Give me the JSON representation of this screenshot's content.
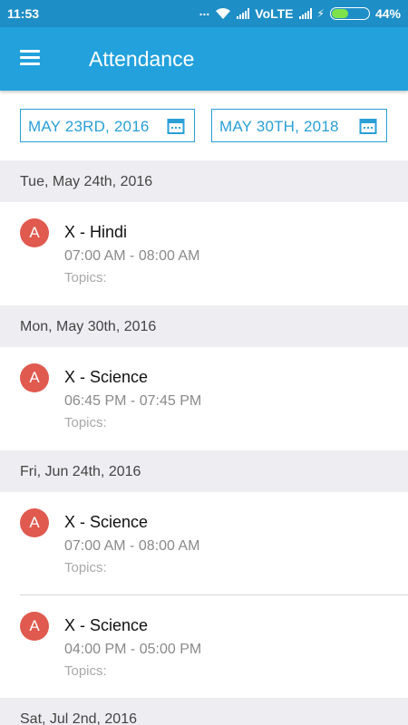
{
  "status_bar": {
    "time": "11:53",
    "dots": "...",
    "network": "VoLTE",
    "charging_icon": "⚡",
    "battery_percent": "44%",
    "battery_level": 0.44
  },
  "app_bar": {
    "menu_icon": "hamburger-menu-icon",
    "title": "Attendance"
  },
  "filters": {
    "from_date": "MAY 23RD, 2016",
    "to_date": "MAY 30TH, 2018",
    "calendar_icon": "calendar-icon"
  },
  "sections": [
    {
      "date": "Tue, May 24th, 2016",
      "items": [
        {
          "badge": "A",
          "subject": "X - Hindi",
          "time": "07:00 AM - 08:00 AM",
          "topics": "Topics:"
        }
      ]
    },
    {
      "date": "Mon, May 30th, 2016",
      "items": [
        {
          "badge": "A",
          "subject": "X - Science",
          "time": "06:45 PM - 07:45 PM",
          "topics": "Topics:"
        }
      ]
    },
    {
      "date": "Fri, Jun 24th, 2016",
      "items": [
        {
          "badge": "A",
          "subject": "X - Science",
          "time": "07:00 AM - 08:00 AM",
          "topics": "Topics:"
        },
        {
          "badge": "A",
          "subject": "X - Science",
          "time": "04:00 PM - 05:00 PM",
          "topics": "Topics:"
        }
      ]
    },
    {
      "date": "Sat, Jul 2nd, 2016",
      "items": []
    }
  ],
  "colors": {
    "status_bar": "#1e8ec6",
    "app_bar": "#22a1dd",
    "accent": "#2a9fd6",
    "badge": "#e05a4f",
    "section_bg": "#eeeef2"
  }
}
